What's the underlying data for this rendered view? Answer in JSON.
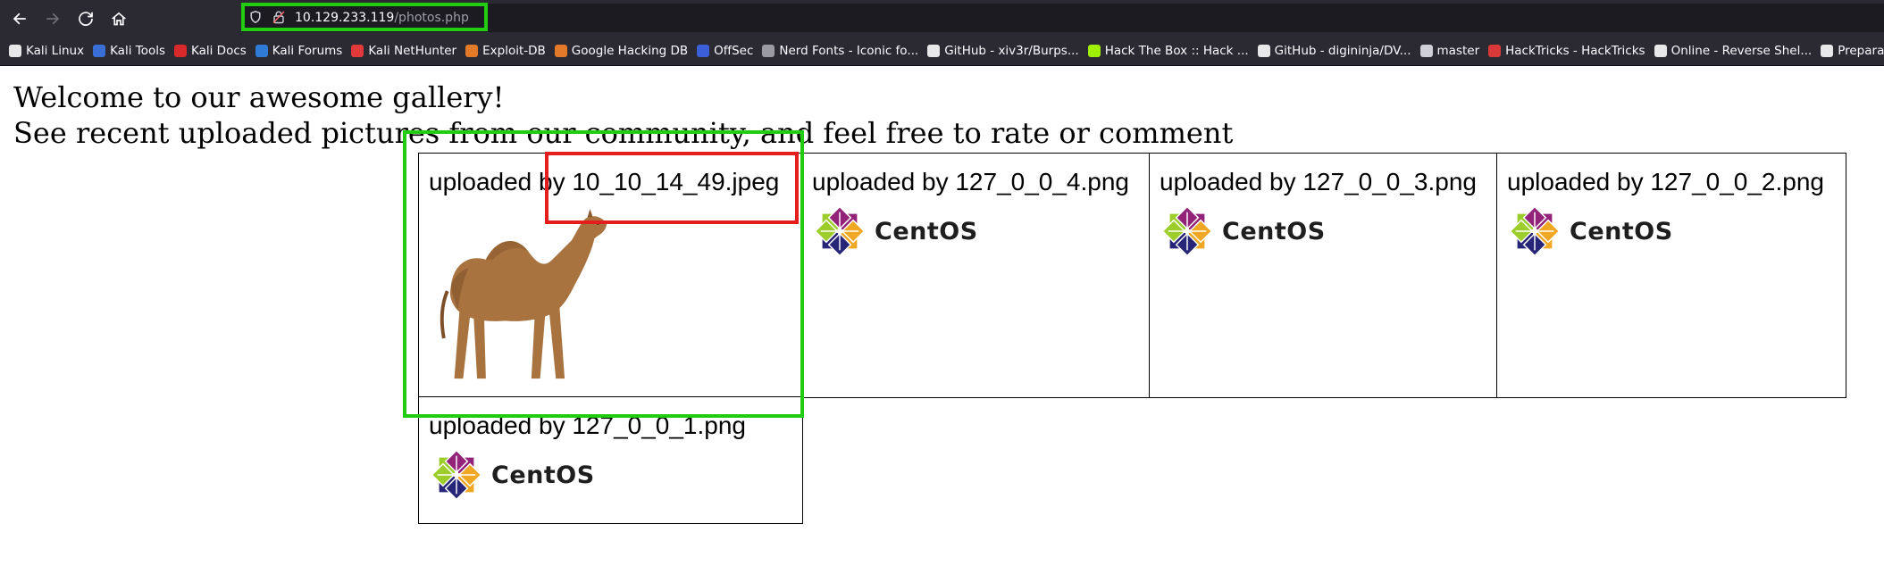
{
  "browser": {
    "url_host": "10.129.233.119",
    "url_path": "/photos.php",
    "bookmarks": [
      {
        "label": "Kali Linux",
        "icon": "kali-dragon-icon",
        "color": "#e8e8ea"
      },
      {
        "label": "Kali Tools",
        "icon": "kali-tools-icon",
        "color": "#3a6fd8"
      },
      {
        "label": "Kali Docs",
        "icon": "kali-docs-icon",
        "color": "#d82a2a"
      },
      {
        "label": "Kali Forums",
        "icon": "kali-forums-icon",
        "color": "#2f7bd6"
      },
      {
        "label": "Kali NetHunter",
        "icon": "nethunter-icon",
        "color": "#e23a3a"
      },
      {
        "label": "Exploit-DB",
        "icon": "exploit-db-icon",
        "color": "#e27a2a"
      },
      {
        "label": "Google Hacking DB",
        "icon": "ghdb-icon",
        "color": "#e27a2a"
      },
      {
        "label": "OffSec",
        "icon": "offsec-icon",
        "color": "#3a5fd8"
      },
      {
        "label": "Nerd Fonts - Iconic fo...",
        "icon": "nerd-fonts-icon",
        "color": "#9a9aa2"
      },
      {
        "label": "GitHub - xiv3r/Burps...",
        "icon": "github-icon",
        "color": "#e8e8ea"
      },
      {
        "label": "Hack The Box :: Hack ...",
        "icon": "htb-cube-icon",
        "color": "#9fef00"
      },
      {
        "label": "GitHub - digininja/DV...",
        "icon": "github-icon",
        "color": "#e8e8ea"
      },
      {
        "label": "master",
        "icon": "folder-icon",
        "color": "#cfcfd8"
      },
      {
        "label": "HackTricks - HackTricks",
        "icon": "hacktricks-icon",
        "color": "#d83a3a"
      },
      {
        "label": "Online - Reverse Shel...",
        "icon": "skull-icon",
        "color": "#e8e8ea"
      },
      {
        "label": "Preparación OSCP...",
        "icon": "github-icon",
        "color": "#e8e8ea"
      }
    ]
  },
  "page": {
    "welcome": "Welcome to our awesome gallery!",
    "subtitle": "See recent uploaded pictures from our community, and feel free to rate or comment",
    "gallery": [
      {
        "caption": "uploaded by 10_10_14_49.jpeg",
        "image": "camel"
      },
      {
        "caption": "uploaded by 127_0_0_4.png",
        "image": "centos-logo"
      },
      {
        "caption": "uploaded by 127_0_0_3.png",
        "image": "centos-logo"
      },
      {
        "caption": "uploaded by 127_0_0_2.png",
        "image": "centos-logo"
      },
      {
        "caption": "uploaded by 127_0_0_1.png",
        "image": "centos-logo"
      }
    ],
    "centos_wordmark": "CentOS"
  },
  "colors": {
    "highlight_green": "#22cc11",
    "highlight_red": "#e41d1d",
    "chrome_bg": "#2b2a33",
    "urlbar_bg": "#1c1b22"
  }
}
